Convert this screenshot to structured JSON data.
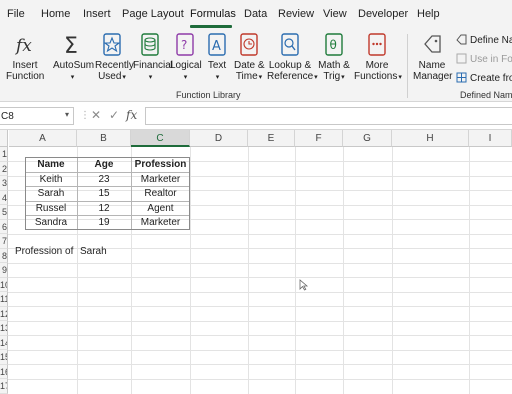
{
  "menu": {
    "items": [
      "File",
      "Home",
      "Insert",
      "Page Layout",
      "Formulas",
      "Data",
      "Review",
      "View",
      "Developer",
      "Help"
    ],
    "active": "Formulas"
  },
  "ribbon": {
    "insert_function": {
      "line1": "Insert",
      "line2": "Function",
      "icon": "fx-icon"
    },
    "autosum": {
      "line1": "AutoSum",
      "icon": "sigma-icon"
    },
    "recently_used": {
      "line1": "Recently",
      "line2": "Used",
      "icon": "star-book-icon"
    },
    "financial": {
      "line1": "Financial",
      "icon": "coins-book-icon"
    },
    "logical": {
      "line1": "Logical",
      "icon": "question-book-icon"
    },
    "text": {
      "line1": "Text",
      "icon": "text-book-icon"
    },
    "date_time": {
      "line1": "Date &",
      "line2": "Time",
      "icon": "clock-book-icon"
    },
    "lookup": {
      "line1": "Lookup &",
      "line2": "Reference",
      "icon": "magnifier-book-icon"
    },
    "math_trig": {
      "line1": "Math &",
      "line2": "Trig",
      "icon": "theta-book-icon"
    },
    "more_functions": {
      "line1": "More",
      "line2": "Functions",
      "icon": "dots-book-icon"
    },
    "function_library_label": "Function Library",
    "name_manager": {
      "line1": "Name",
      "line2": "Manager",
      "icon": "tag-icon"
    },
    "define_name": "Define Nar",
    "use_in_formula": "Use in For",
    "create_from": "Create fro",
    "defined_names_label": "Defined Names",
    "accent_color": "#1e6b3a"
  },
  "formula_bar": {
    "name_box": "C8",
    "formula": ""
  },
  "sheet": {
    "columns": [
      "A",
      "B",
      "C",
      "D",
      "E",
      "F",
      "G",
      "H",
      "I"
    ],
    "selected_column": "C",
    "rows": [
      "1",
      "2",
      "3",
      "4",
      "5",
      "6",
      "7",
      "8",
      "9",
      "10",
      "11",
      "12",
      "13",
      "14",
      "15",
      "16",
      "17"
    ],
    "table": {
      "headers": [
        "Name",
        "Age",
        "Profession"
      ],
      "rows": [
        [
          "Keith",
          "23",
          "Marketer"
        ],
        [
          "Sarah",
          "15",
          "Realtor"
        ],
        [
          "Russel",
          "12",
          "Agent"
        ],
        [
          "Sandra",
          "19",
          "Marketer"
        ]
      ]
    },
    "lookup_label": "Profession of",
    "lookup_value": "Sarah"
  }
}
